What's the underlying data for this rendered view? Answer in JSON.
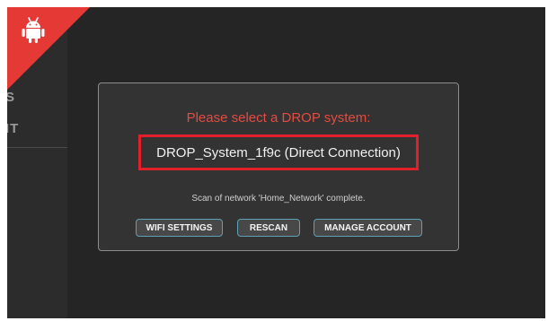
{
  "sidebar": {
    "partial_label_1": "S",
    "partial_label_2": "IT"
  },
  "corner_badge": {
    "icon": "android-icon",
    "color": "#e53935"
  },
  "dialog": {
    "title": "Please select a DROP system:",
    "systems": [
      {
        "label": "DROP_System_1f9c (Direct Connection)",
        "selected": true
      }
    ],
    "status": "Scan of network 'Home_Network' complete.",
    "buttons": {
      "wifi_settings": "WIFI SETTINGS",
      "rescan": "RESCAN",
      "manage_account": "MANAGE ACCOUNT"
    }
  },
  "colors": {
    "title_red": "#e54b40",
    "highlight_red": "#e0202a",
    "button_border": "#5fa0b4",
    "background": "#252525"
  }
}
